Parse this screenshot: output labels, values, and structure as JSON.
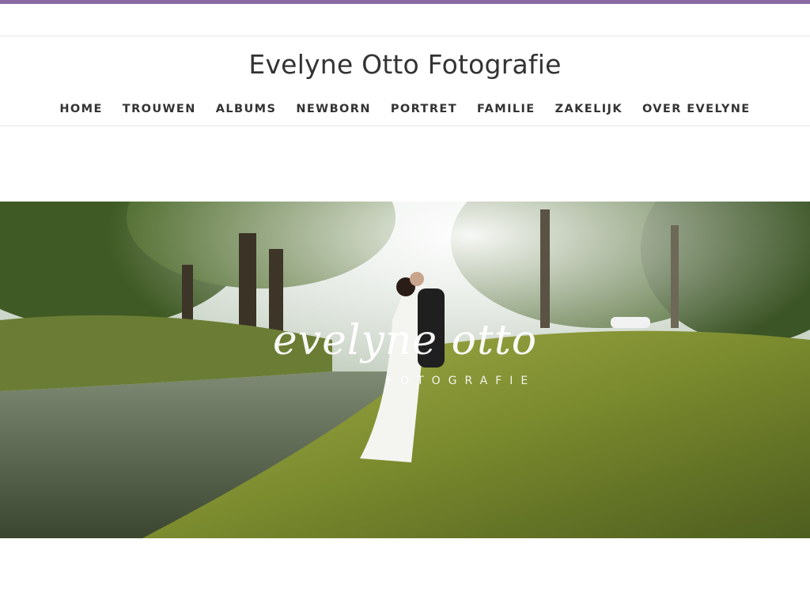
{
  "header": {
    "site_title": "Evelyne Otto Fotografie"
  },
  "nav": {
    "items": [
      {
        "label": "HOME",
        "name": "nav-item-home"
      },
      {
        "label": "TROUWEN",
        "name": "nav-item-trouwen"
      },
      {
        "label": "ALBUMS",
        "name": "nav-item-albums"
      },
      {
        "label": "NEWBORN",
        "name": "nav-item-newborn"
      },
      {
        "label": "PORTRET",
        "name": "nav-item-portret"
      },
      {
        "label": "FAMILIE",
        "name": "nav-item-familie"
      },
      {
        "label": "ZAKELIJK",
        "name": "nav-item-zakelijk"
      },
      {
        "label": "OVER EVELYNE",
        "name": "nav-item-over-evelyne"
      }
    ]
  },
  "hero": {
    "logo_script": "evelyne otto",
    "logo_subtitle": "FOTOGRAFIE"
  },
  "colors": {
    "accent_bar": "#8a6aa3",
    "text": "#333333"
  }
}
